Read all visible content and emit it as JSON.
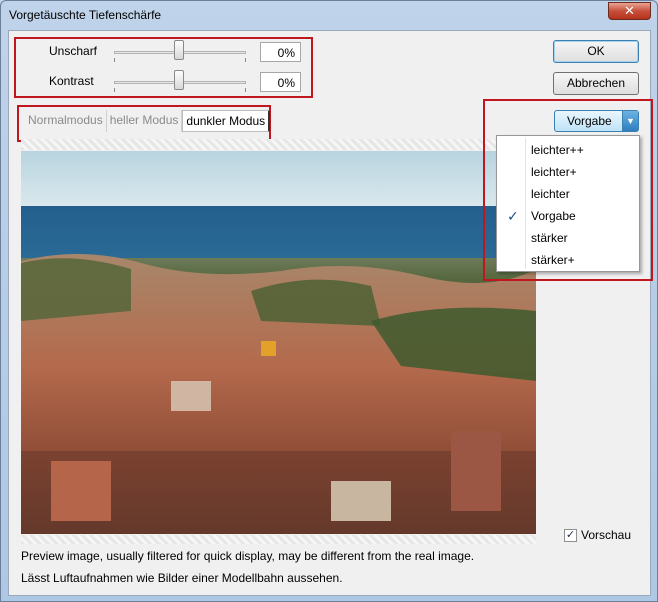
{
  "window": {
    "title": "Vorgetäuschte Tiefenschärfe",
    "close_label": "✕"
  },
  "sliders": [
    {
      "label": "Unscharf",
      "value": "0%"
    },
    {
      "label": "Kontrast",
      "value": "0%"
    }
  ],
  "buttons": {
    "ok": "OK",
    "cancel": "Abbrechen"
  },
  "tabs": [
    {
      "label": "Normalmodus",
      "active": false
    },
    {
      "label": "heller Modus",
      "active": false
    },
    {
      "label": "dunkler Modus",
      "active": true
    }
  ],
  "preset": {
    "selected": "Vorgabe",
    "arrow": "▼",
    "options": [
      "leichter++",
      "leichter+",
      "leichter",
      "Vorgabe",
      "stärker",
      "stärker+"
    ],
    "check_glyph": "✓"
  },
  "preview_checkbox": {
    "label": "Vorschau",
    "checked": true,
    "glyph": "✓"
  },
  "info": {
    "line1": "Preview image, usually filtered for quick display, may be different from the real image.",
    "line2": "Lässt Luftaufnahmen wie Bilder einer Modellbahn aussehen."
  },
  "colors": {
    "highlight_box": "#c0161d",
    "accent": "#3c7fb1"
  }
}
